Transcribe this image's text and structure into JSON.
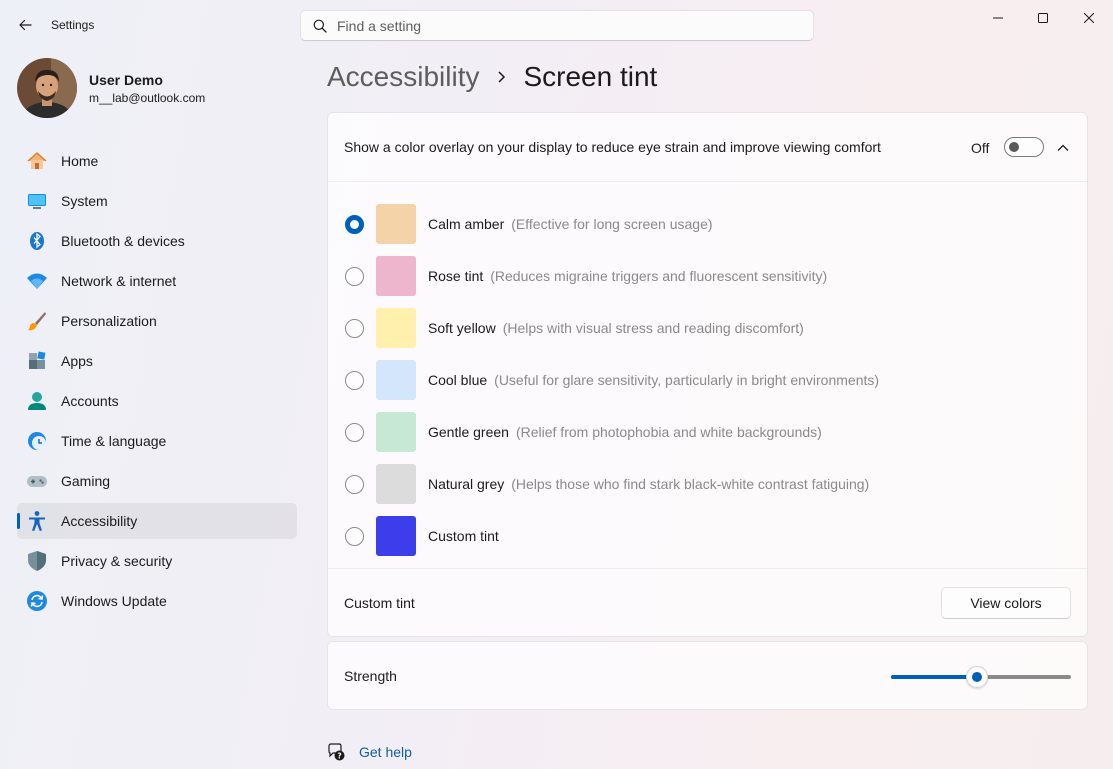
{
  "window": {
    "title": "Settings"
  },
  "search": {
    "placeholder": "Find a setting",
    "value": ""
  },
  "profile": {
    "name": "User Demo",
    "email": "m__lab@outlook.com"
  },
  "sidebar": {
    "items": [
      {
        "label": "Home",
        "icon": "home-icon"
      },
      {
        "label": "System",
        "icon": "system-icon"
      },
      {
        "label": "Bluetooth & devices",
        "icon": "bluetooth-icon"
      },
      {
        "label": "Network & internet",
        "icon": "network-icon"
      },
      {
        "label": "Personalization",
        "icon": "brush-icon"
      },
      {
        "label": "Apps",
        "icon": "apps-icon"
      },
      {
        "label": "Accounts",
        "icon": "accounts-icon"
      },
      {
        "label": "Time & language",
        "icon": "time-language-icon"
      },
      {
        "label": "Gaming",
        "icon": "gaming-icon"
      },
      {
        "label": "Accessibility",
        "icon": "accessibility-icon",
        "active": true
      },
      {
        "label": "Privacy & security",
        "icon": "shield-icon"
      },
      {
        "label": "Windows Update",
        "icon": "update-icon"
      }
    ]
  },
  "breadcrumb": {
    "parent": "Accessibility",
    "current": "Screen tint"
  },
  "overlay": {
    "description": "Show a color overlay on your display to reduce eye strain and improve viewing comfort",
    "toggle_state": "Off",
    "enabled": false
  },
  "tints": [
    {
      "name": "Calm amber",
      "desc": "(Effective for long screen usage)",
      "color": "#f3d3a7",
      "selected": true
    },
    {
      "name": "Rose tint",
      "desc": "(Reduces migraine triggers and fluorescent sensitivity)",
      "color": "#edb6cc",
      "selected": false
    },
    {
      "name": "Soft yellow",
      "desc": "(Helps with visual stress and reading discomfort)",
      "color": "#fff1ad",
      "selected": false
    },
    {
      "name": "Cool blue",
      "desc": "(Useful for glare sensitivity, particularly in bright environments)",
      "color": "#d3e6fb",
      "selected": false
    },
    {
      "name": "Gentle green",
      "desc": "(Relief from photophobia and white backgrounds)",
      "color": "#c6e8d5",
      "selected": false
    },
    {
      "name": "Natural grey",
      "desc": "(Helps those who find stark black-white contrast fatiguing)",
      "color": "#dcdcdc",
      "selected": false
    },
    {
      "name": "Custom tint",
      "desc": "",
      "color": "#3d3dec",
      "selected": false
    }
  ],
  "custom_tint": {
    "label": "Custom tint",
    "button_label": "View colors"
  },
  "strength": {
    "label": "Strength",
    "value_fraction": 0.48
  },
  "help": {
    "label": "Get help"
  },
  "colors": {
    "accent": "#005fb8"
  }
}
